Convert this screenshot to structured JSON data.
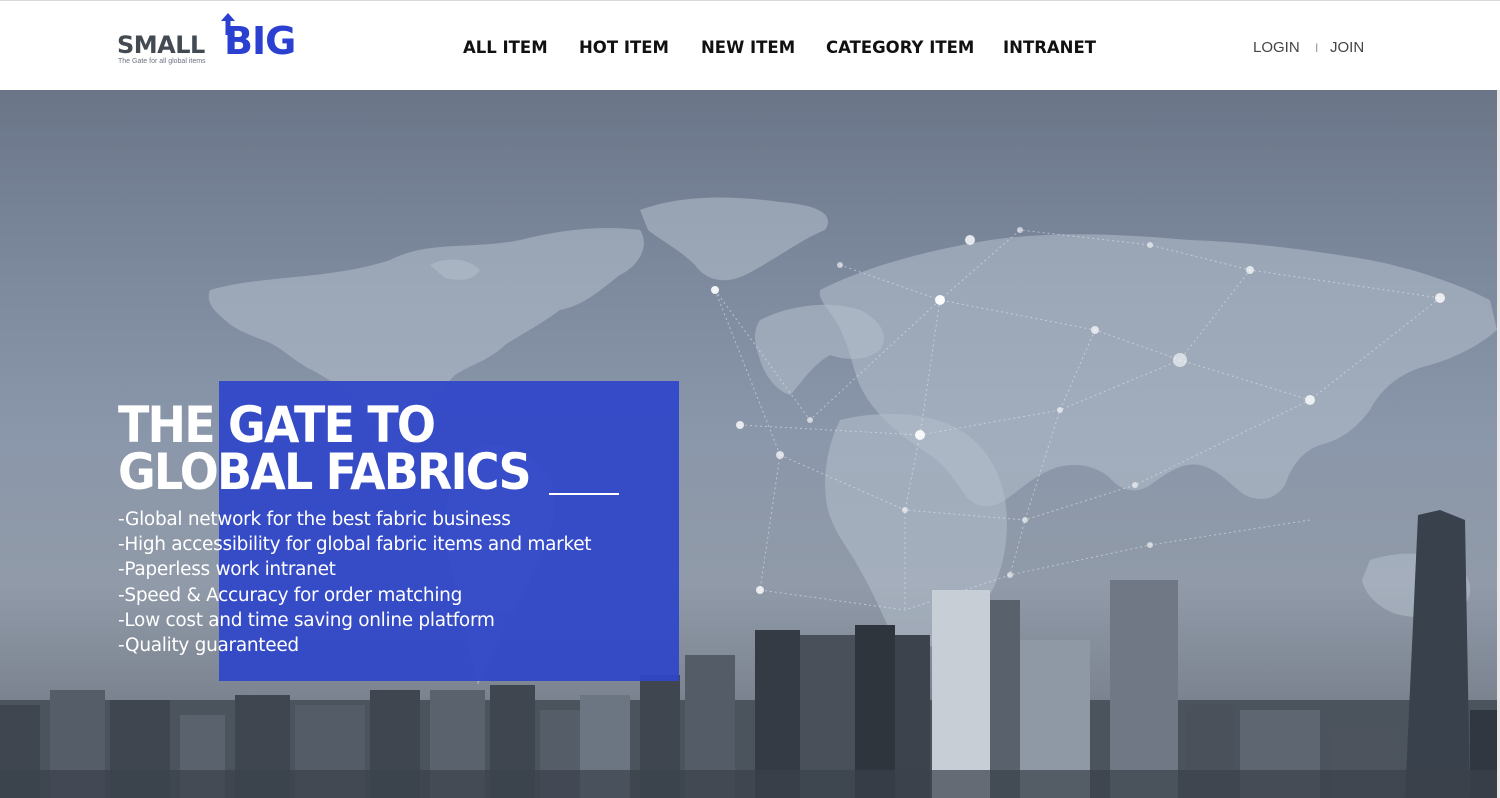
{
  "header": {
    "logo": {
      "small": "SMALL",
      "big": "BIG",
      "tagline": "The Gate for all global items"
    },
    "nav": [
      {
        "label": "ALL ITEM"
      },
      {
        "label": "HOT ITEM"
      },
      {
        "label": "NEW ITEM"
      },
      {
        "label": "CATEGORY ITEM"
      },
      {
        "label": "INTRANET"
      }
    ],
    "auth": {
      "login": "LOGIN",
      "separator": "I",
      "join": "JOIN"
    }
  },
  "hero": {
    "headline_line1": "THE GATE TO",
    "headline_line2": "GLOBAL FABRICS",
    "features": [
      "-Global network for the best fabric business",
      "-High accessibility for global fabric items and market",
      "-Paperless work intranet",
      "-Speed & Accuracy for order matching",
      "-Low cost and time saving online platform",
      "-Quality guaranteed"
    ]
  },
  "colors": {
    "brand_blue": "#2b3fd0",
    "highlight_box": "#2f46c9",
    "logo_gray": "#444a52",
    "nav_text": "#111111"
  },
  "icons": [
    "logo-arrow-icon",
    "world-map-network-graphic",
    "city-skyline-graphic"
  ]
}
